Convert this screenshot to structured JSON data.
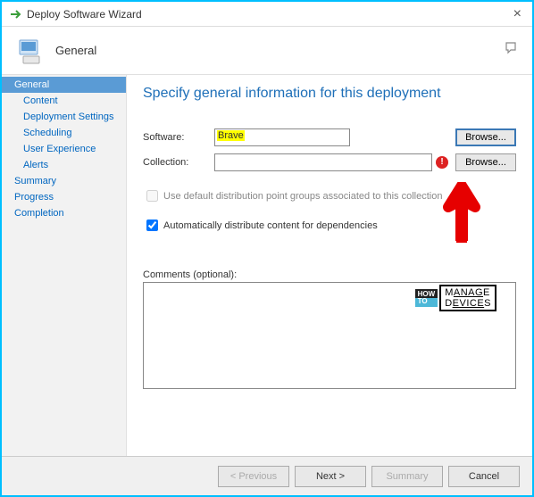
{
  "window": {
    "title": "Deploy Software Wizard"
  },
  "header": {
    "title": "General"
  },
  "sidebar": {
    "items": [
      {
        "label": "General",
        "active": true,
        "sub": false
      },
      {
        "label": "Content",
        "active": false,
        "sub": true
      },
      {
        "label": "Deployment Settings",
        "active": false,
        "sub": true
      },
      {
        "label": "Scheduling",
        "active": false,
        "sub": true
      },
      {
        "label": "User Experience",
        "active": false,
        "sub": true
      },
      {
        "label": "Alerts",
        "active": false,
        "sub": true
      },
      {
        "label": "Summary",
        "active": false,
        "sub": false
      },
      {
        "label": "Progress",
        "active": false,
        "sub": false
      },
      {
        "label": "Completion",
        "active": false,
        "sub": false
      }
    ]
  },
  "main": {
    "heading": "Specify general information for this deployment",
    "software_label": "Software:",
    "software_value": "Brave",
    "collection_label": "Collection:",
    "collection_value": "",
    "browse_label": "Browse...",
    "cb_default": "Use default distribution point groups associated to this collection",
    "cb_auto": "Automatically distribute content for dependencies",
    "comments_label": "Comments (optional):",
    "comments_value": ""
  },
  "footer": {
    "previous": "< Previous",
    "next": "Next >",
    "summary": "Summary",
    "cancel": "Cancel"
  }
}
